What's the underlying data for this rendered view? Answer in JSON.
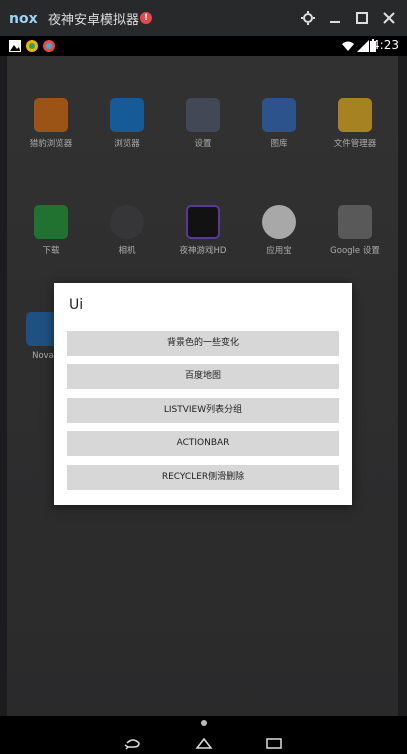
{
  "emulator": {
    "title": "夜神安卓模拟器",
    "alert_mark": "!",
    "controls": [
      "settings-icon",
      "minimize-icon",
      "maximize-icon",
      "close-icon"
    ]
  },
  "status_bar": {
    "time": "4:23"
  },
  "apps": [
    {
      "label": "猎豹浏览器",
      "icon": "cheetah-browser-icon",
      "color": "#d8741f"
    },
    {
      "label": "浏览器",
      "icon": "browser-icon",
      "color": "#1f7fd1"
    },
    {
      "label": "设置",
      "icon": "settings-app-icon",
      "color": "#5c6476"
    },
    {
      "label": "图库",
      "icon": "gallery-icon",
      "color": "#3f73c2"
    },
    {
      "label": "文件管理器",
      "icon": "folder-icon",
      "color": "#e8b430"
    },
    {
      "label": "下载",
      "icon": "download-icon",
      "color": "#2f9e44"
    },
    {
      "label": "相机",
      "icon": "camera-icon",
      "color": "#4c4c50"
    },
    {
      "label": "夜神游戏HD",
      "icon": "nox-game-icon",
      "color": "#1a1a1a"
    },
    {
      "label": "应用宝",
      "icon": "app-store-icon",
      "color": "#e9e9e9"
    },
    {
      "label": "Google 设置",
      "icon": "google-settings-icon",
      "color": "#7c7c7c"
    },
    {
      "label": "Nova",
      "icon": "nova-icon",
      "color": "#2b6fb5"
    }
  ],
  "dialog": {
    "title": "Ui",
    "items": [
      "背景色的一些变化",
      "百度地图",
      "LISTVIEW列表分组",
      "ACTIONBAR",
      "RECYCLER侧滑删除"
    ]
  }
}
